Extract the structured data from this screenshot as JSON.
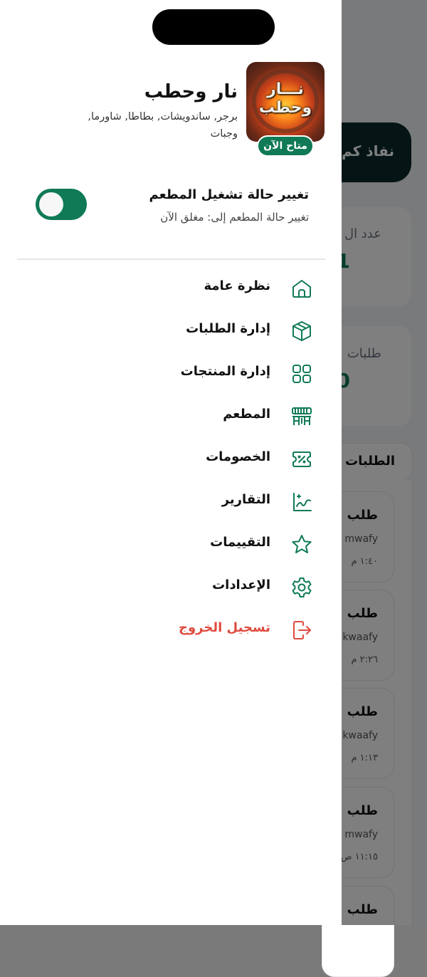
{
  "background": {
    "banner_text": "نفاذ كم",
    "card1": {
      "label": "عدد ال",
      "value": "1"
    },
    "card2": {
      "label": "طلبات",
      "value": "0"
    },
    "tab_label": "الطلبات",
    "orders": [
      {
        "title": "طلب",
        "user": "mwafy",
        "time": "١:٤٠ م"
      },
      {
        "title": "طلب",
        "user": "kwaafy",
        "time": "٢:٢٦ م"
      },
      {
        "title": "طلب",
        "user": "kwaafy",
        "time": "١:١٣ م"
      },
      {
        "title": "طلب",
        "user": "mwafy",
        "time": "١١:١٥ ص"
      },
      {
        "title": "طلب",
        "user": "",
        "time": ""
      }
    ]
  },
  "restaurant": {
    "logo_text_line1": "نـــار",
    "logo_text_line2": "وحطب",
    "name": "نار وحطب",
    "description": "برجر, ساندويشات, بطاطا, شاورما, وجبات",
    "status_badge": "متاح الآن"
  },
  "status_toggle": {
    "title": "تغيير حالة تشغيل المطعم",
    "subtitle": "تغيير حالة المطعم إلى: مغلق الآن",
    "on": true
  },
  "menu": [
    {
      "key": "overview",
      "label": "نظرة عامة",
      "icon": "home-icon"
    },
    {
      "key": "orders",
      "label": "إدارة الطلبات",
      "icon": "box-icon"
    },
    {
      "key": "products",
      "label": "إدارة المنتجات",
      "icon": "grid-icon"
    },
    {
      "key": "restaurant",
      "label": "المطعم",
      "icon": "store-icon"
    },
    {
      "key": "discounts",
      "label": "الخصومات",
      "icon": "discount-icon"
    },
    {
      "key": "reports",
      "label": "التقارير",
      "icon": "chart-icon"
    },
    {
      "key": "ratings",
      "label": "التقييمات",
      "icon": "star-icon"
    },
    {
      "key": "settings",
      "label": "الإعدادات",
      "icon": "gear-icon"
    },
    {
      "key": "logout",
      "label": "تسجيل الخروج",
      "icon": "logout-icon"
    }
  ],
  "colors": {
    "accent": "#0f7a55",
    "logout": "#e04b3f"
  }
}
